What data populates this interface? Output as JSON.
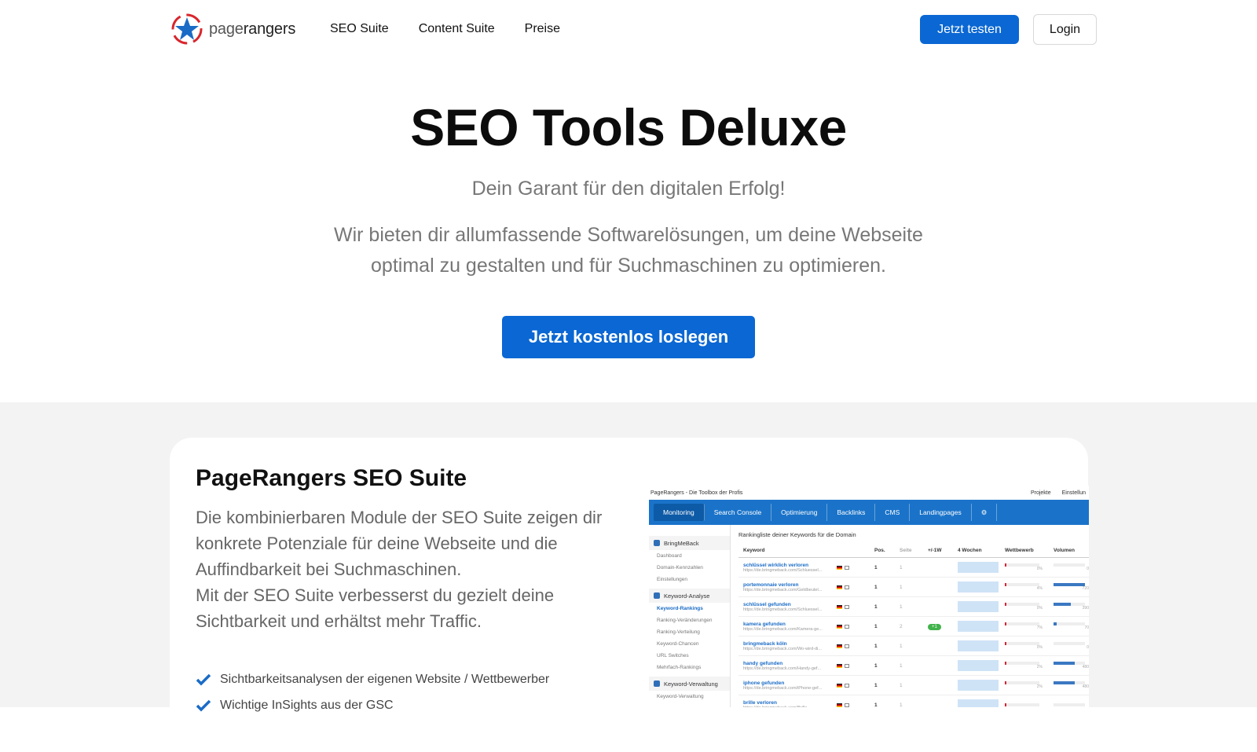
{
  "nav": {
    "logo_part1": "page",
    "logo_part2": "rangers",
    "menu": [
      "SEO Suite",
      "Content Suite",
      "Preise"
    ],
    "try_label": "Jetzt testen",
    "login_label": "Login",
    "accent": "#0a67d3"
  },
  "hero": {
    "title": "SEO Tools Deluxe",
    "subtitle": "Dein Garant für den digitalen Erfolg!",
    "text": "Wir bieten dir allumfassende Softwarelösungen, um deine Webseite optimal zu gestalten und für Suchmaschinen zu optimieren.",
    "cta_label": "Jetzt kostenlos loslegen"
  },
  "suite": {
    "title": "PageRangers SEO Suite",
    "text1": "Die kombinierbaren Module der SEO Suite zeigen dir konkrete Potenziale für deine Webseite und die Auffindbarkeit bei Suchmaschinen.",
    "text2": "Mit der SEO Suite verbesserst du gezielt deine Sichtbarkeit und erhältst mehr Traffic.",
    "checks": [
      "Sichtbarkeitsanalysen der eigenen Website / Wettbewerber",
      "Wichtige InSights aus der GSC"
    ]
  },
  "screenshot": {
    "app_title": "PageRangers - Die Toolbox der Profis",
    "top_right": [
      "Projekte",
      "Einstellun"
    ],
    "tabs": [
      "Monitoring",
      "Search Console",
      "Optimierung",
      "Backlinks",
      "CMS",
      "Landingpages",
      "⚙"
    ],
    "sidebar": [
      {
        "group": "BringMeBack",
        "items": [
          "Dashboard",
          "Domain-Kennzahlen",
          "Einstellungen"
        ]
      },
      {
        "group": "Keyword-Analyse",
        "items": [
          "Keyword-Rankings",
          "Ranking-Veränderungen",
          "Ranking-Verteilung",
          "Keyword-Chancen",
          "URL Switches",
          "Mehrfach-Rankings"
        ]
      },
      {
        "group": "Keyword-Verwaltung",
        "items": [
          "Keyword-Verwaltung"
        ]
      }
    ],
    "table_caption": "Rankingliste deiner Keywords für die Domain",
    "columns": [
      "Keyword",
      "Pos.",
      "Seite",
      "+/-1W",
      "4 Wochen",
      "Wettbewerb",
      "Volumen"
    ],
    "rows": [
      {
        "kw": "schlüssel wirklich verloren",
        "url": "https://de.bringmeback.com/Schluessel...",
        "pos": "1",
        "seite": "1",
        "delta": "",
        "wb": "0%",
        "vol": "0"
      },
      {
        "kw": "portemonnaie verloren",
        "url": "https://de.bringmeback.com/Geldbeutel...",
        "pos": "1",
        "seite": "1",
        "delta": "",
        "wb": "4%",
        "vol": "720"
      },
      {
        "kw": "schlüssel gefunden",
        "url": "https://de.bringmeback.com/Schluessel...",
        "pos": "1",
        "seite": "1",
        "delta": "",
        "wb": "0%",
        "vol": "390"
      },
      {
        "kw": "kamera gefunden",
        "url": "https://de.bringmeback.com/Kamera-ge...",
        "pos": "1",
        "seite": "2",
        "delta": "+1",
        "wb": "7%",
        "vol": "70"
      },
      {
        "kw": "bringmeback köln",
        "url": "https://de.bringmeback.com/Wo-wird-di...",
        "pos": "1",
        "seite": "1",
        "delta": "",
        "wb": "0%",
        "vol": "0"
      },
      {
        "kw": "handy gefunden",
        "url": "https://de.bringmeback.com/Handy-gef...",
        "pos": "1",
        "seite": "1",
        "delta": "",
        "wb": "2%",
        "vol": "480"
      },
      {
        "kw": "iphone gefunden",
        "url": "https://de.bringmeback.com/iPhone-gef...",
        "pos": "1",
        "seite": "1",
        "delta": "",
        "wb": "2%",
        "vol": "480"
      },
      {
        "kw": "brille verloren",
        "url": "https://de.bringmeback.com/Brille...",
        "pos": "1",
        "seite": "1",
        "delta": "",
        "wb": "",
        "vol": ""
      }
    ]
  }
}
